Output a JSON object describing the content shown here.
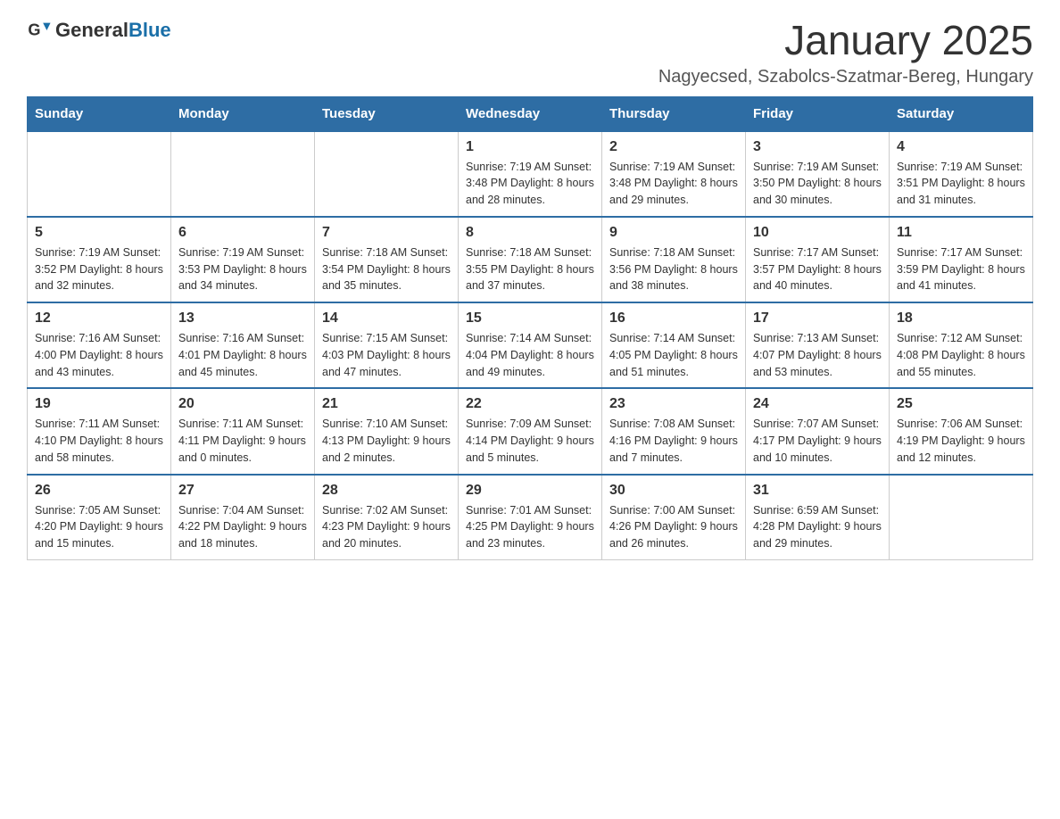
{
  "header": {
    "logo_general": "General",
    "logo_blue": "Blue",
    "month_year": "January 2025",
    "location": "Nagyecsed, Szabolcs-Szatmar-Bereg, Hungary"
  },
  "days_of_week": [
    "Sunday",
    "Monday",
    "Tuesday",
    "Wednesday",
    "Thursday",
    "Friday",
    "Saturday"
  ],
  "weeks": [
    [
      {
        "day": "",
        "info": ""
      },
      {
        "day": "",
        "info": ""
      },
      {
        "day": "",
        "info": ""
      },
      {
        "day": "1",
        "info": "Sunrise: 7:19 AM\nSunset: 3:48 PM\nDaylight: 8 hours\nand 28 minutes."
      },
      {
        "day": "2",
        "info": "Sunrise: 7:19 AM\nSunset: 3:48 PM\nDaylight: 8 hours\nand 29 minutes."
      },
      {
        "day": "3",
        "info": "Sunrise: 7:19 AM\nSunset: 3:50 PM\nDaylight: 8 hours\nand 30 minutes."
      },
      {
        "day": "4",
        "info": "Sunrise: 7:19 AM\nSunset: 3:51 PM\nDaylight: 8 hours\nand 31 minutes."
      }
    ],
    [
      {
        "day": "5",
        "info": "Sunrise: 7:19 AM\nSunset: 3:52 PM\nDaylight: 8 hours\nand 32 minutes."
      },
      {
        "day": "6",
        "info": "Sunrise: 7:19 AM\nSunset: 3:53 PM\nDaylight: 8 hours\nand 34 minutes."
      },
      {
        "day": "7",
        "info": "Sunrise: 7:18 AM\nSunset: 3:54 PM\nDaylight: 8 hours\nand 35 minutes."
      },
      {
        "day": "8",
        "info": "Sunrise: 7:18 AM\nSunset: 3:55 PM\nDaylight: 8 hours\nand 37 minutes."
      },
      {
        "day": "9",
        "info": "Sunrise: 7:18 AM\nSunset: 3:56 PM\nDaylight: 8 hours\nand 38 minutes."
      },
      {
        "day": "10",
        "info": "Sunrise: 7:17 AM\nSunset: 3:57 PM\nDaylight: 8 hours\nand 40 minutes."
      },
      {
        "day": "11",
        "info": "Sunrise: 7:17 AM\nSunset: 3:59 PM\nDaylight: 8 hours\nand 41 minutes."
      }
    ],
    [
      {
        "day": "12",
        "info": "Sunrise: 7:16 AM\nSunset: 4:00 PM\nDaylight: 8 hours\nand 43 minutes."
      },
      {
        "day": "13",
        "info": "Sunrise: 7:16 AM\nSunset: 4:01 PM\nDaylight: 8 hours\nand 45 minutes."
      },
      {
        "day": "14",
        "info": "Sunrise: 7:15 AM\nSunset: 4:03 PM\nDaylight: 8 hours\nand 47 minutes."
      },
      {
        "day": "15",
        "info": "Sunrise: 7:14 AM\nSunset: 4:04 PM\nDaylight: 8 hours\nand 49 minutes."
      },
      {
        "day": "16",
        "info": "Sunrise: 7:14 AM\nSunset: 4:05 PM\nDaylight: 8 hours\nand 51 minutes."
      },
      {
        "day": "17",
        "info": "Sunrise: 7:13 AM\nSunset: 4:07 PM\nDaylight: 8 hours\nand 53 minutes."
      },
      {
        "day": "18",
        "info": "Sunrise: 7:12 AM\nSunset: 4:08 PM\nDaylight: 8 hours\nand 55 minutes."
      }
    ],
    [
      {
        "day": "19",
        "info": "Sunrise: 7:11 AM\nSunset: 4:10 PM\nDaylight: 8 hours\nand 58 minutes."
      },
      {
        "day": "20",
        "info": "Sunrise: 7:11 AM\nSunset: 4:11 PM\nDaylight: 9 hours\nand 0 minutes."
      },
      {
        "day": "21",
        "info": "Sunrise: 7:10 AM\nSunset: 4:13 PM\nDaylight: 9 hours\nand 2 minutes."
      },
      {
        "day": "22",
        "info": "Sunrise: 7:09 AM\nSunset: 4:14 PM\nDaylight: 9 hours\nand 5 minutes."
      },
      {
        "day": "23",
        "info": "Sunrise: 7:08 AM\nSunset: 4:16 PM\nDaylight: 9 hours\nand 7 minutes."
      },
      {
        "day": "24",
        "info": "Sunrise: 7:07 AM\nSunset: 4:17 PM\nDaylight: 9 hours\nand 10 minutes."
      },
      {
        "day": "25",
        "info": "Sunrise: 7:06 AM\nSunset: 4:19 PM\nDaylight: 9 hours\nand 12 minutes."
      }
    ],
    [
      {
        "day": "26",
        "info": "Sunrise: 7:05 AM\nSunset: 4:20 PM\nDaylight: 9 hours\nand 15 minutes."
      },
      {
        "day": "27",
        "info": "Sunrise: 7:04 AM\nSunset: 4:22 PM\nDaylight: 9 hours\nand 18 minutes."
      },
      {
        "day": "28",
        "info": "Sunrise: 7:02 AM\nSunset: 4:23 PM\nDaylight: 9 hours\nand 20 minutes."
      },
      {
        "day": "29",
        "info": "Sunrise: 7:01 AM\nSunset: 4:25 PM\nDaylight: 9 hours\nand 23 minutes."
      },
      {
        "day": "30",
        "info": "Sunrise: 7:00 AM\nSunset: 4:26 PM\nDaylight: 9 hours\nand 26 minutes."
      },
      {
        "day": "31",
        "info": "Sunrise: 6:59 AM\nSunset: 4:28 PM\nDaylight: 9 hours\nand 29 minutes."
      },
      {
        "day": "",
        "info": ""
      }
    ]
  ]
}
